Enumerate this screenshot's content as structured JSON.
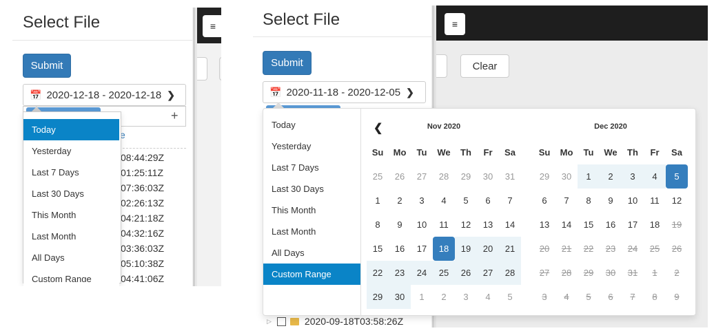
{
  "left": {
    "title": "Select File",
    "submit_label": "Submit",
    "date_range": "2020-12-18 - 2020-12-18",
    "plus_label": "+",
    "partial_link_text": "e",
    "ranges": [
      "Today",
      "Yesterday",
      "Last 7 Days",
      "Last 30 Days",
      "This Month",
      "Last Month",
      "All Days",
      "Custom Range"
    ],
    "active_range": "Today",
    "timestamps": [
      "08:44:29Z",
      "01:25:11Z",
      "07:36:03Z",
      "02:26:13Z",
      "04:21:18Z",
      "04:32:16Z",
      "03:36:03Z",
      "05:10:38Z",
      "04:41:06Z"
    ]
  },
  "right": {
    "title": "Select File",
    "submit_label": "Submit",
    "clear_label": "Clear",
    "date_range": "2020-11-18 - 2020-12-05",
    "ranges": [
      "Today",
      "Yesterday",
      "Last 7 Days",
      "Last 30 Days",
      "This Month",
      "Last Month",
      "All Days",
      "Custom Range"
    ],
    "active_range": "Custom Range",
    "weekdays": [
      "Su",
      "Mo",
      "Tu",
      "We",
      "Th",
      "Fr",
      "Sa"
    ],
    "calendars": [
      {
        "month": "Nov 2020",
        "weeks": [
          [
            {
              "d": "25",
              "s": "off"
            },
            {
              "d": "26",
              "s": "off"
            },
            {
              "d": "27",
              "s": "off"
            },
            {
              "d": "28",
              "s": "off"
            },
            {
              "d": "29",
              "s": "off"
            },
            {
              "d": "30",
              "s": "off"
            },
            {
              "d": "31",
              "s": "off"
            }
          ],
          [
            {
              "d": "1"
            },
            {
              "d": "2"
            },
            {
              "d": "3"
            },
            {
              "d": "4"
            },
            {
              "d": "5"
            },
            {
              "d": "6"
            },
            {
              "d": "7"
            }
          ],
          [
            {
              "d": "8"
            },
            {
              "d": "9"
            },
            {
              "d": "10"
            },
            {
              "d": "11"
            },
            {
              "d": "12"
            },
            {
              "d": "13"
            },
            {
              "d": "14"
            }
          ],
          [
            {
              "d": "15"
            },
            {
              "d": "16"
            },
            {
              "d": "17"
            },
            {
              "d": "18",
              "s": "sel"
            },
            {
              "d": "19",
              "s": "range"
            },
            {
              "d": "20",
              "s": "range"
            },
            {
              "d": "21",
              "s": "range"
            }
          ],
          [
            {
              "d": "22",
              "s": "range"
            },
            {
              "d": "23",
              "s": "range"
            },
            {
              "d": "24",
              "s": "range"
            },
            {
              "d": "25",
              "s": "range"
            },
            {
              "d": "26",
              "s": "range"
            },
            {
              "d": "27",
              "s": "range"
            },
            {
              "d": "28",
              "s": "range"
            }
          ],
          [
            {
              "d": "29",
              "s": "range"
            },
            {
              "d": "30",
              "s": "range"
            },
            {
              "d": "1",
              "s": "off"
            },
            {
              "d": "2",
              "s": "off"
            },
            {
              "d": "3",
              "s": "off"
            },
            {
              "d": "4",
              "s": "off"
            },
            {
              "d": "5",
              "s": "off"
            }
          ]
        ]
      },
      {
        "month": "Dec 2020",
        "weeks": [
          [
            {
              "d": "29",
              "s": "off"
            },
            {
              "d": "30",
              "s": "off"
            },
            {
              "d": "1",
              "s": "range"
            },
            {
              "d": "2",
              "s": "range"
            },
            {
              "d": "3",
              "s": "range"
            },
            {
              "d": "4",
              "s": "range"
            },
            {
              "d": "5",
              "s": "sel"
            }
          ],
          [
            {
              "d": "6"
            },
            {
              "d": "7"
            },
            {
              "d": "8"
            },
            {
              "d": "9"
            },
            {
              "d": "10"
            },
            {
              "d": "11"
            },
            {
              "d": "12"
            }
          ],
          [
            {
              "d": "13"
            },
            {
              "d": "14"
            },
            {
              "d": "15"
            },
            {
              "d": "16"
            },
            {
              "d": "17"
            },
            {
              "d": "18"
            },
            {
              "d": "19",
              "s": "dis"
            }
          ],
          [
            {
              "d": "20",
              "s": "dis"
            },
            {
              "d": "21",
              "s": "dis"
            },
            {
              "d": "22",
              "s": "dis"
            },
            {
              "d": "23",
              "s": "dis"
            },
            {
              "d": "24",
              "s": "dis"
            },
            {
              "d": "25",
              "s": "dis"
            },
            {
              "d": "26",
              "s": "dis"
            }
          ],
          [
            {
              "d": "27",
              "s": "dis"
            },
            {
              "d": "28",
              "s": "dis"
            },
            {
              "d": "29",
              "s": "dis"
            },
            {
              "d": "30",
              "s": "dis"
            },
            {
              "d": "31",
              "s": "dis"
            },
            {
              "d": "1",
              "s": "dis"
            },
            {
              "d": "2",
              "s": "dis"
            }
          ],
          [
            {
              "d": "3",
              "s": "dis"
            },
            {
              "d": "4",
              "s": "dis"
            },
            {
              "d": "5",
              "s": "dis"
            },
            {
              "d": "6",
              "s": "dis"
            },
            {
              "d": "7",
              "s": "dis"
            },
            {
              "d": "8",
              "s": "dis"
            },
            {
              "d": "9",
              "s": "dis"
            }
          ]
        ]
      }
    ],
    "tree_item": "2020-09-18T03:58:26Z"
  },
  "colors": {
    "primary": "#337ab7",
    "active_range": "#0a84c7",
    "selected_day": "#357ebd",
    "in_range": "#ebf4f8"
  },
  "icons": [
    "hamburger-menu-icon",
    "calendar-icon",
    "chevron-down-icon",
    "chevron-left-icon",
    "plus-icon",
    "folder-icon",
    "checkbox-icon",
    "tree-expand-icon"
  ]
}
